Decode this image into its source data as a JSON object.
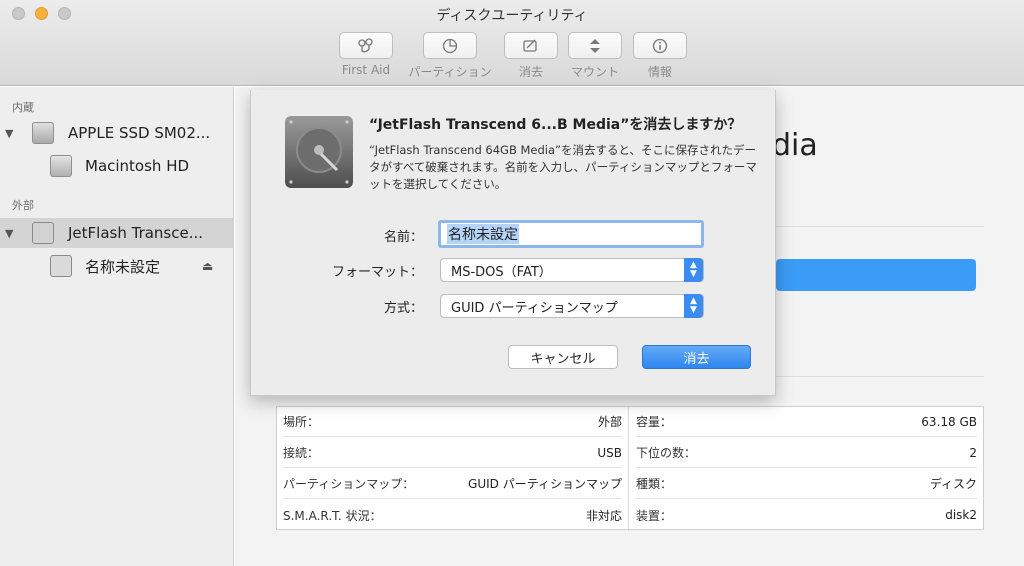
{
  "window": {
    "title": "ディスクユーティリティ"
  },
  "toolbar": {
    "items": [
      {
        "label": "First Aid",
        "icon": "stethoscope-icon"
      },
      {
        "label": "パーティション",
        "icon": "partition-pie-icon"
      },
      {
        "label": "消去",
        "icon": "erase-icon"
      },
      {
        "label": "マウント",
        "icon": "mount-icon"
      },
      {
        "label": "情報",
        "icon": "info-icon"
      }
    ]
  },
  "sidebar": {
    "internal_header": "内蔵",
    "external_header": "外部",
    "internal_disk": "APPLE SSD SM02...",
    "internal_volume": "Macintosh HD",
    "external_disk": "JetFlash Transce...",
    "external_volume": "名称未設定"
  },
  "main": {
    "title_fragment": "dia"
  },
  "dialog": {
    "title": "“JetFlash Transcend 6...B Media”を消去しますか？",
    "message": "“JetFlash Transcend 64GB Media”を消去すると、そこに保存されたデータがすべて破棄されます。名前を入力し、パーティションマップとフォーマットを選択してください。",
    "name_label": "名前：",
    "name_value": "名称未設定",
    "format_label": "フォーマット：",
    "format_value": "MS-DOS（FAT）",
    "scheme_label": "方式：",
    "scheme_value": "GUID パーティションマップ",
    "cancel_label": "キャンセル",
    "erase_label": "消去"
  },
  "info": {
    "left": [
      {
        "key": "場所：",
        "value": "外部"
      },
      {
        "key": "接続：",
        "value": "USB"
      },
      {
        "key": "パーティションマップ：",
        "value": "GUID パーティションマップ"
      },
      {
        "key": "S.M.A.R.T. 状況：",
        "value": "非対応"
      }
    ],
    "right": [
      {
        "key": "容量：",
        "value": "63.18 GB"
      },
      {
        "key": "下位の数：",
        "value": "2"
      },
      {
        "key": "種類：",
        "value": "ディスク"
      },
      {
        "key": "装置：",
        "value": "disk2"
      }
    ]
  },
  "colors": {
    "accent": "#3b8cf0",
    "sidebar_selection": "#d4d4d4"
  }
}
